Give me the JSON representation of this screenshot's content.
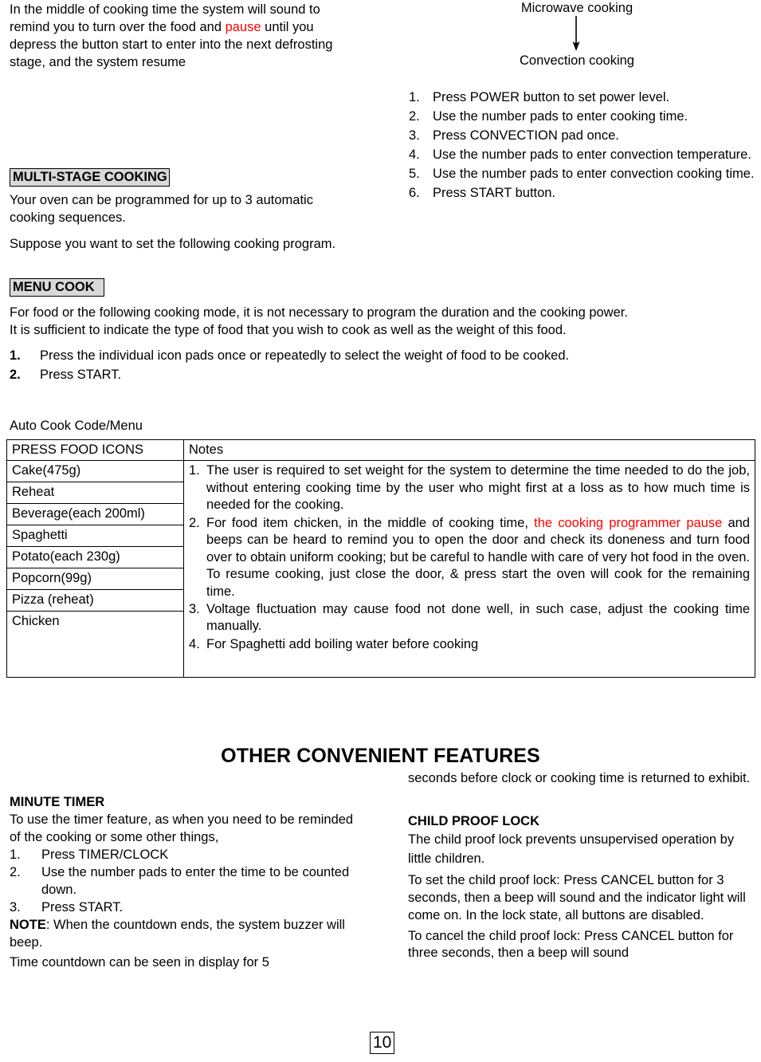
{
  "document": {
    "page_number": "10"
  },
  "intro_paragraph": {
    "part1": "In the middle of cooking time the system will sound to remind you to turn over the food and ",
    "highlight": "pause",
    "part2": " until you depress the button start to enter into the next defrosting stage, and the system resume"
  },
  "diagram": {
    "top_label": "Microwave cooking",
    "bottom_label": "Convection cooking",
    "arrow": "down-arrow"
  },
  "convection_steps": {
    "items": [
      {
        "num": "1.",
        "text": "Press POWER button to set power level."
      },
      {
        "num": "2.",
        "text": "Use the number pads to enter cooking time."
      },
      {
        "num": "3.",
        "text": "Press CONVECTION pad once."
      },
      {
        "num": "4.",
        "text": "Use the number pads to enter convection temperature."
      },
      {
        "num": "5.",
        "text": "Use the number pads to enter convection cooking time."
      },
      {
        "num": "6.",
        "text": "Press START button."
      }
    ]
  },
  "multi_stage": {
    "heading": "MULTI-STAGE COOKING",
    "para1": "Your oven can be programmed for up to 3 automatic cooking sequences.",
    "para2": "Suppose you want to set the following cooking program."
  },
  "menu_cook": {
    "heading": "MENU COOK  ",
    "para1": "For food or the following cooking mode, it is not necessary to program the duration and the cooking power.",
    "para2": "It is sufficient to indicate the type of food that you wish to cook as well as the weight of this food.",
    "steps": [
      {
        "num": "1.",
        "text": "Press the individual icon pads once or repeatedly to select the weight of food to be cooked."
      },
      {
        "num": "2.",
        "text": "Press START."
      }
    ]
  },
  "auto_cook": {
    "caption": "Auto Cook Code/Menu",
    "columns": [
      "PRESS FOOD ICONS",
      "Notes"
    ],
    "foods": [
      "Cake(475g)",
      "Reheat",
      "Beverage(each 200ml)",
      "Spaghetti",
      "Potato(each 230g)",
      "Popcorn(99g)",
      "Pizza (reheat)",
      "Chicken"
    ],
    "notes": [
      {
        "num": "1.",
        "segments": [
          {
            "text": "The user is required to set weight for the system to determine the time needed to do the job, without entering cooking time by the user who might first at a loss as to how much time is needed for the cooking.",
            "color": "black"
          }
        ]
      },
      {
        "num": "2.",
        "segments": [
          {
            "text": "For food item chicken, in the middle of cooking time, ",
            "color": "black"
          },
          {
            "text": "the cooking programmer pause",
            "color": "red"
          },
          {
            "text": " and beeps can be heard to remind you to open the door and check its doneness and turn food over to obtain uniform cooking; but be careful to handle with care of very hot food in the oven. To resume cooking, just close the door, & press start the oven will cook for the remaining time.",
            "color": "black"
          }
        ]
      },
      {
        "num": "3.",
        "segments": [
          {
            "text": "Voltage fluctuation may cause food not done well, in such case, adjust the cooking time manually.",
            "color": "black"
          }
        ]
      },
      {
        "num": "4.",
        "segments": [
          {
            "text": "For Spaghetti add boiling water before cooking",
            "color": "black"
          }
        ]
      }
    ]
  },
  "other_features": {
    "title": "OTHER CONVENIENT FEATURES"
  },
  "minute_timer": {
    "heading": "MINUTE TIMER",
    "intro": "To use the timer feature, as when you need to be reminded of the cooking or some other things,",
    "steps": [
      {
        "num": "1.",
        "text": "Press TIMER/CLOCK"
      },
      {
        "num": "2.",
        "text": "Use the number pads to enter the time to be counted down."
      },
      {
        "num": "3.",
        "text": "Press START."
      }
    ],
    "note_label": "NOTE",
    "note_text": ": When the countdown ends, the system buzzer will beep.",
    "tail": "Time countdown can be seen in display for 5"
  },
  "child_lock": {
    "continued": "seconds before clock or cooking time is returned to exhibit.",
    "heading": "CHILD PROOF LOCK",
    "para1": "The child proof lock prevents unsupervised operation by little children.",
    "para2": "To set the child proof lock: Press CANCEL button for 3 seconds, then a beep will sound and the indicator light will come on. In the lock state, all buttons are disabled.",
    "para3": "To cancel the child proof lock: Press CANCEL button for three seconds, then a beep will sound"
  },
  "colors": {
    "highlight_red": "#ff0000",
    "heading_fill": "#d9d9d9",
    "text": "#000000"
  }
}
